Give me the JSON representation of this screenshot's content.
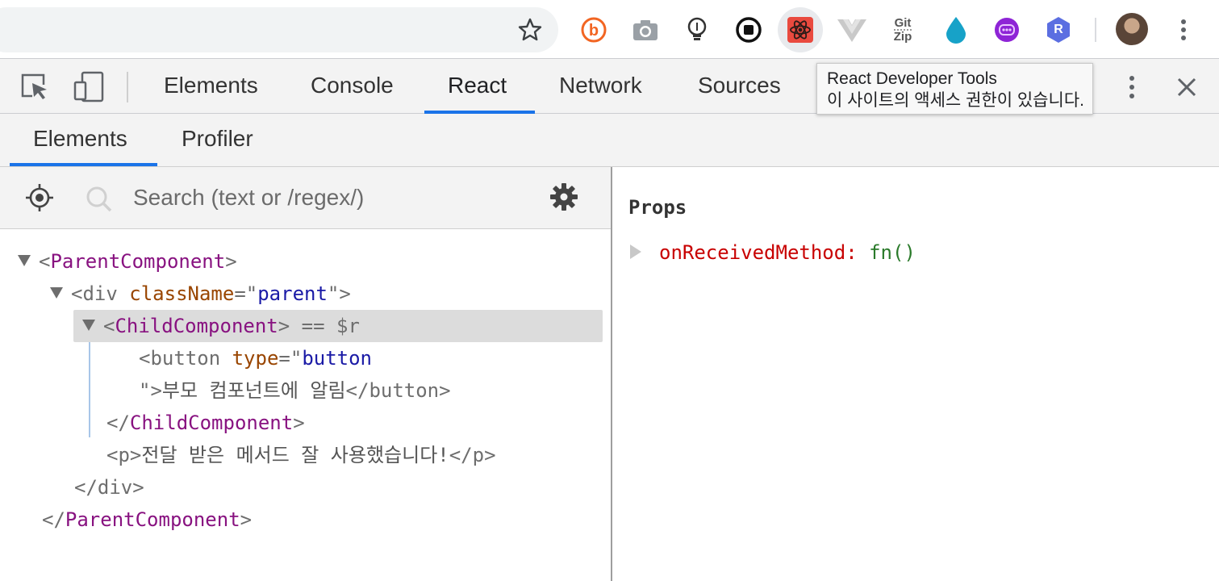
{
  "browser": {
    "extensions": [
      "b-extension-icon",
      "camera-icon",
      "bulb-icon",
      "record-icon",
      "react-icon",
      "vue-icon",
      "gitzip-icon",
      "drop-icon",
      "purple-extension-icon",
      "r-extension-icon"
    ],
    "gitzip_label_top": "Git",
    "gitzip_label_bottom": "Zip",
    "r_label": "R"
  },
  "devtools": {
    "tabs": [
      {
        "label": "Elements"
      },
      {
        "label": "Console"
      },
      {
        "label": "React"
      },
      {
        "label": "Network"
      },
      {
        "label": "Sources"
      }
    ],
    "selected_tab": "React"
  },
  "tooltip": {
    "line1": "React Developer Tools",
    "line2": "이 사이트의 액세스 권한이 있습니다."
  },
  "react": {
    "subtabs": [
      {
        "label": "Elements"
      },
      {
        "label": "Profiler"
      }
    ],
    "search": {
      "placeholder": "Search (text or /regex/)"
    },
    "tree": {
      "parent_open": "<ParentComponent>",
      "parent_name": "ParentComponent",
      "div_tag": "div",
      "div_attr": "className",
      "div_val": "parent",
      "child_name": "ChildComponent",
      "child_marker": " == $r",
      "button_tag": "button",
      "button_attr": "type",
      "button_val": "button",
      "button_text": "부모 컴포넌트에 알림",
      "p_text": "전달 받은 메서드 잘 사용했습니다!"
    },
    "props": {
      "title": "Props",
      "items": [
        {
          "key": "onReceivedMethod",
          "value": "fn()"
        }
      ]
    }
  },
  "colors": {
    "accent": "#1a73e8",
    "component": "#881280",
    "attribute": "#994500",
    "attr_value": "#1a1aa6",
    "prop_key": "#c80000",
    "prop_value": "#2a7a2a"
  }
}
